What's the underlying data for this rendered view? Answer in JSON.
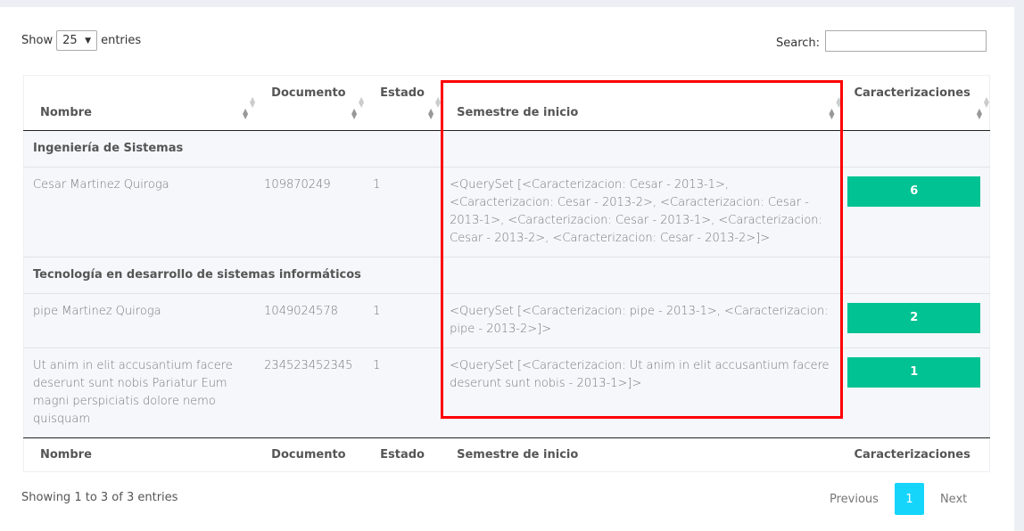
{
  "length": {
    "show": "Show",
    "value": "25",
    "entries": "entries"
  },
  "search": {
    "label": "Search:",
    "value": ""
  },
  "columns": [
    "Nombre",
    "Documento",
    "Estado",
    "Semestre de inicio",
    "Caracterizaciones"
  ],
  "groups": [
    {
      "name": "Ingeniería de Sistemas",
      "rows": [
        {
          "nombre": "Cesar Martinez Quiroga",
          "documento": "109870249",
          "estado": "1",
          "semestre": "<QuerySet [<Caracterizacion: Cesar - 2013-1>, <Caracterizacion: Cesar - 2013-2>, <Caracterizacion: Cesar - 2013-1>, <Caracterizacion: Cesar - 2013-1>, <Caracterizacion: Cesar - 2013-2>, <Caracterizacion: Cesar - 2013-2>]>",
          "caracterizaciones": "6"
        }
      ]
    },
    {
      "name": "Tecnología en desarrollo de sistemas informáticos",
      "rows": [
        {
          "nombre": "pipe Martinez Quiroga",
          "documento": "1049024578",
          "estado": "1",
          "semestre": "<QuerySet [<Caracterizacion: pipe - 2013-1>, <Caracterizacion: pipe - 2013-2>]>",
          "caracterizaciones": "2"
        },
        {
          "nombre": "Ut anim in elit accusantium facere deserunt sunt nobis Pariatur Eum magni perspiciatis dolore nemo quisquam",
          "documento": "234523452345",
          "estado": "1",
          "semestre": "<QuerySet [<Caracterizacion: Ut anim in elit accusantium facere deserunt sunt nobis - 2013-1>]>",
          "caracterizaciones": "1"
        }
      ]
    }
  ],
  "info": "Showing 1 to 3 of 3 entries",
  "pagination": {
    "previous": "Previous",
    "current": "1",
    "next": "Next"
  },
  "colors": {
    "badge": "#00c292",
    "page_active": "#15d5fb",
    "highlight": "#ff0000"
  }
}
